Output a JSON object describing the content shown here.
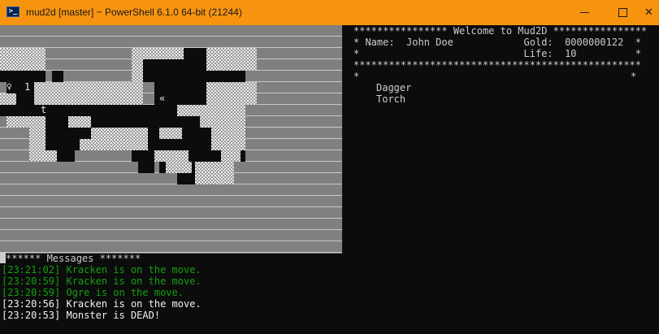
{
  "window": {
    "title": "mud2d [master] ~ PowerShell 6.1.0 64-bit (21244)",
    "icon": "powershell-icon",
    "controls": {
      "minimize": "minimize-icon",
      "maximize": "maximize-icon",
      "close": "close-icon"
    },
    "titlebar_color": "#f7940f"
  },
  "map": {
    "player_glyph": "♀",
    "markers": [
      "1",
      "t",
      "«"
    ]
  },
  "info": {
    "header": "**************** Welcome to Mud2D ****************",
    "name_row": "* Name:  John Doe            Gold:  0000000122  *",
    "life_row": "*                            Life:  10          *",
    "divider": "*************************************************",
    "blank_row_left": "*",
    "blank_row_right": "*"
  },
  "inventory": [
    "Dagger",
    "Torch"
  ],
  "messages": {
    "header": "****** Messages *******",
    "items": [
      {
        "text": "[23:21:02] Kracken is on the move.",
        "color": "#13a10e"
      },
      {
        "text": "[23:20:59] Kracken is on the move.",
        "color": "#13a10e"
      },
      {
        "text": "[23:20:59] Ogre is on the move.",
        "color": "#13a10e"
      },
      {
        "text": "[23:20:56] Kracken is on the move.",
        "color": "#f2f2f2"
      },
      {
        "text": "[23:20:53] Monster is DEAD!",
        "color": "#f2f2f2"
      }
    ]
  }
}
